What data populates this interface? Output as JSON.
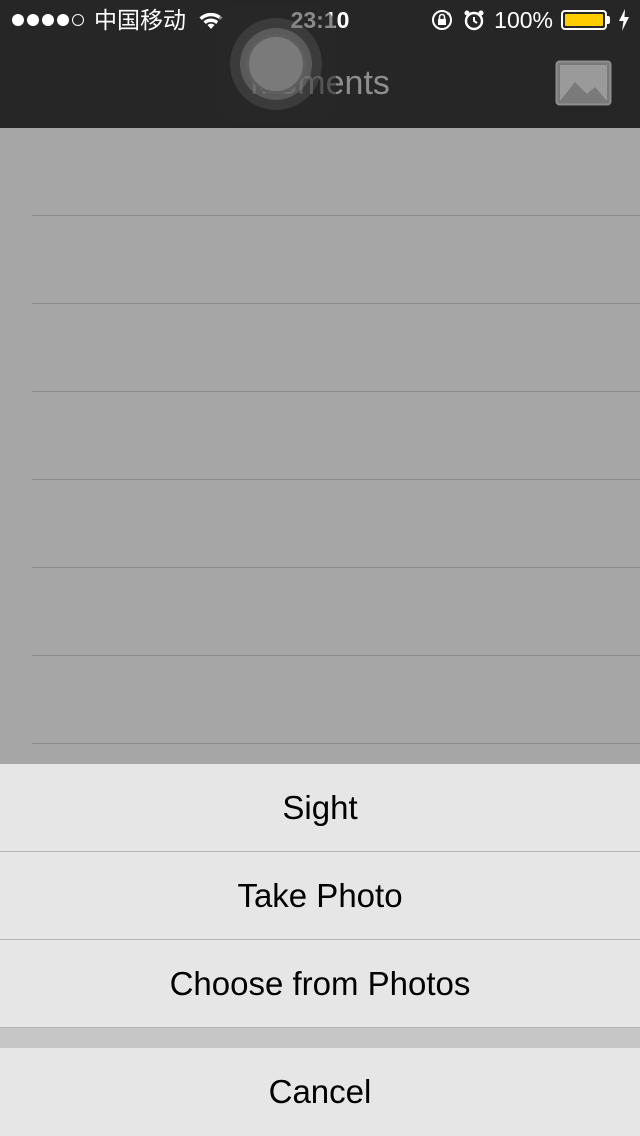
{
  "status_bar": {
    "carrier": "中国移动",
    "time": "23:10",
    "battery_percent": "100%",
    "battery_level": 1.0,
    "signal_bars_filled": 4,
    "signal_bars_total": 5,
    "icons": [
      "wifi-icon",
      "orientation-lock-icon",
      "alarm-icon",
      "battery-icon",
      "charging-icon"
    ],
    "battery_color": "#ffcc00"
  },
  "nav": {
    "title": "Moments",
    "right_button_icon": "photo-icon"
  },
  "action_sheet": {
    "options": [
      "Sight",
      "Take Photo",
      "Choose from Photos"
    ],
    "cancel_label": "Cancel"
  },
  "colors": {
    "header_bg": "#262626",
    "overlay_bg": "#a6a6a6",
    "sheet_bg": "#e6e6e6"
  }
}
